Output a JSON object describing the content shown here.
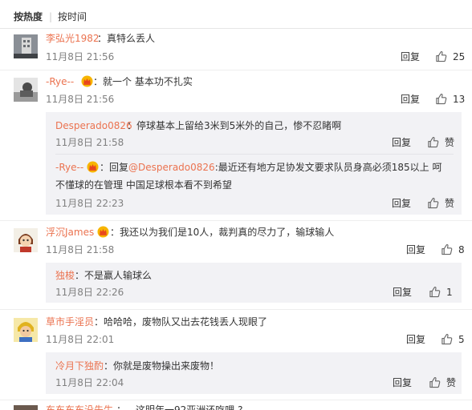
{
  "sort": {
    "hot_label": "按热度",
    "time_label": "按时间"
  },
  "comments": [
    {
      "user": "李弘光1982",
      "text": "：真特么丢人",
      "time": "11月8日 21:56",
      "reply_label": "回复",
      "likes": "25"
    },
    {
      "user": "-Rye--",
      "text": "：就一个 基本功不扎实",
      "time": "11月8日 21:56",
      "reply_label": "回复",
      "likes": "13",
      "replies": [
        {
          "user": "Desperado0826",
          "text": "：停球基本上留给3米到5米外的自己，惨不忍睹啊",
          "time": "11月8日 21:58",
          "reply_label": "回复",
          "like_label": "赞"
        },
        {
          "user": "-Rye--",
          "text_prefix": "：回复",
          "mention": "@Desperado0826",
          "text": ":最近还有地方足协发文要求队员身高必须185以上 呵 不懂球的在管理 中国足球根本看不到希望",
          "time": "11月8日 22:23",
          "reply_label": "回复",
          "like_label": "赞"
        }
      ]
    },
    {
      "user": "浮沉James",
      "text": "：我还以为我们是10人，裁判真的尽力了，输球输人",
      "time": "11月8日 21:58",
      "reply_label": "回复",
      "likes": "8",
      "replies": [
        {
          "user": "独梭",
          "text": "：不是赢人输球么",
          "time": "11月8日 22:26",
          "reply_label": "回复",
          "likes": "1"
        }
      ]
    },
    {
      "user": "草市手淫员",
      "text": "：哈哈哈，废物队又出去花钱丢人现眼了",
      "time": "11月8日 22:01",
      "reply_label": "回复",
      "likes": "5",
      "replies": [
        {
          "user": "冷月下独酌",
          "text": "：你就是废物操出来废物！",
          "time": "11月8日 22:04",
          "reply_label": "回复",
          "like_label": "赞"
        }
      ]
    }
  ],
  "partial_comment": {
    "user": "东东东东没先生",
    "text": "：…这明年一92亚洲还吃哩 ?"
  },
  "colors": {
    "username": "#eb7350",
    "reply_bg": "#f2f2f5",
    "time": "#808080",
    "divider": "#eeeeee"
  },
  "icons": {
    "like": "thumbs-up-icon",
    "badge": "vip-crown-icon"
  }
}
